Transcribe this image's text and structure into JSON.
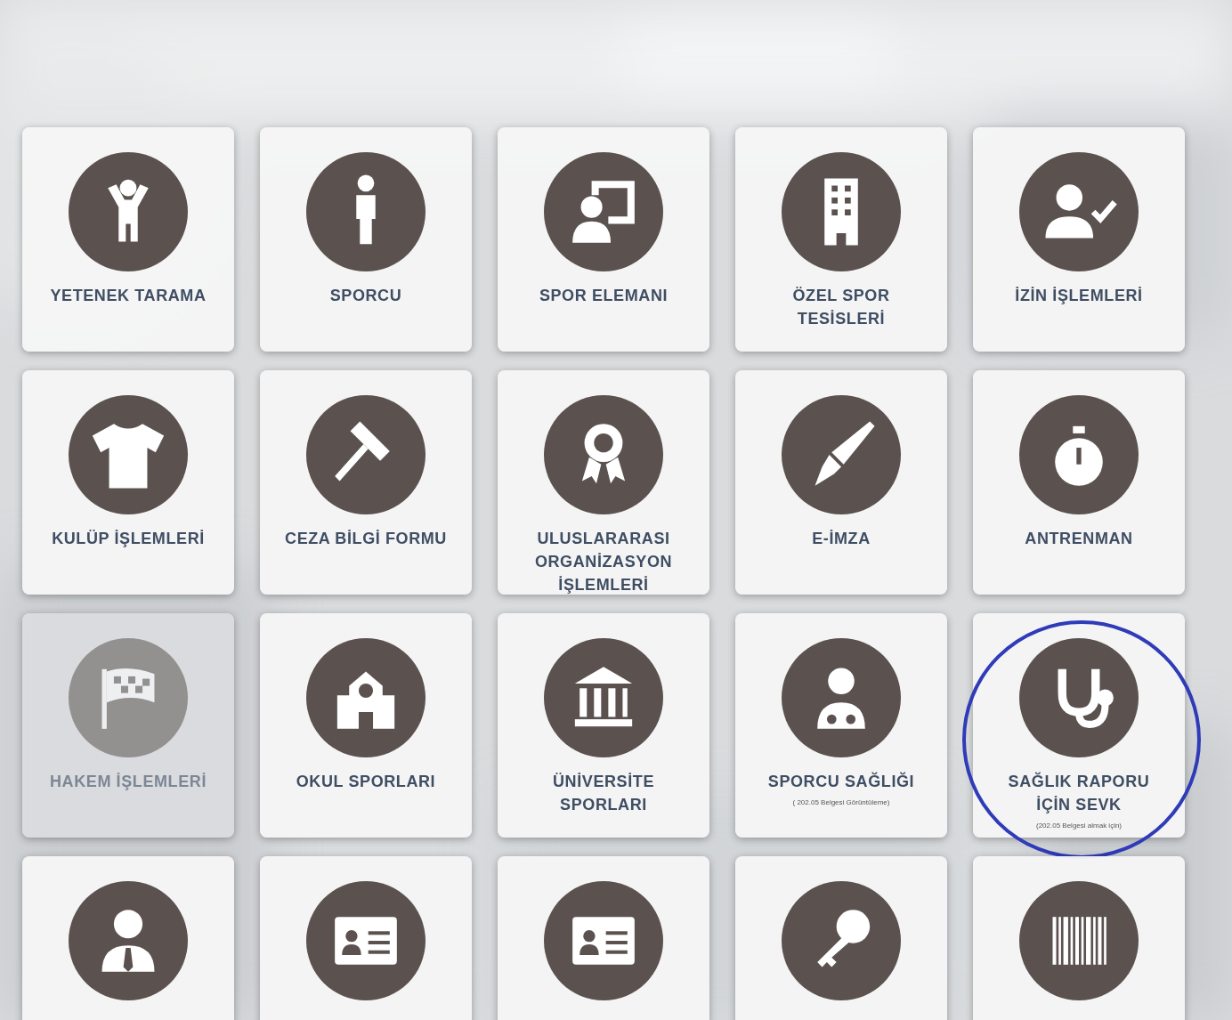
{
  "items": [
    {
      "label": "YETENEK TARAMA",
      "disabled": false
    },
    {
      "label": "SPORCU",
      "disabled": false
    },
    {
      "label": "SPOR ELEMANI",
      "disabled": false
    },
    {
      "label": "ÖZEL SPOR TESİSLERİ",
      "disabled": false
    },
    {
      "label": "İZİN İŞLEMLERİ",
      "disabled": false
    },
    {
      "label": "KULÜP İŞLEMLERİ",
      "disabled": false
    },
    {
      "label": "CEZA BİLGİ FORMU",
      "disabled": false
    },
    {
      "label": "ULUSLARARASI ORGANİZASYON İŞLEMLERİ",
      "disabled": false
    },
    {
      "label": "E-İMZA",
      "disabled": false
    },
    {
      "label": "ANTRENMAN",
      "disabled": false
    },
    {
      "label": "HAKEM İŞLEMLERİ",
      "disabled": true
    },
    {
      "label": "OKUL SPORLARI",
      "disabled": false
    },
    {
      "label": "ÜNİVERSİTE SPORLARI",
      "disabled": false
    },
    {
      "label": "SPORCU SAĞLIĞI",
      "note": "( 202.05 Belgesi Görüntüleme)",
      "disabled": false
    },
    {
      "label": "SAĞLIK RAPORU İÇİN SEVK",
      "note": "(202.05 Belgesi almak için)",
      "disabled": false,
      "circled": true
    },
    {
      "disabled": false
    },
    {
      "disabled": false
    },
    {
      "disabled": false
    },
    {
      "disabled": false
    },
    {
      "disabled": false
    }
  ]
}
